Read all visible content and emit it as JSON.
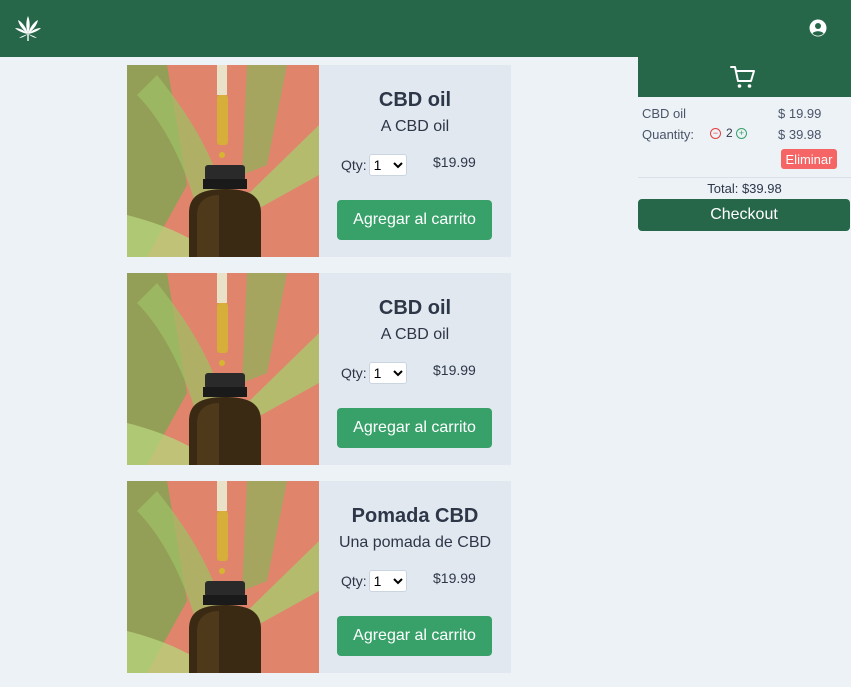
{
  "header": {
    "logo_icon": "cannabis-leaf-icon",
    "user_icon": "user-circle-icon",
    "bg_color": "#276749"
  },
  "products": [
    {
      "title": "CBD oil",
      "description": "A CBD oil",
      "qty_label": "Qty:",
      "qty_value": "1",
      "price": "$19.99",
      "add_label": "Agregar al carrito"
    },
    {
      "title": "CBD oil",
      "description": "A CBD oil",
      "qty_label": "Qty:",
      "qty_value": "1",
      "price": "$19.99",
      "add_label": "Agregar al carrito"
    },
    {
      "title": "Pomada CBD",
      "description": "Una pomada de CBD",
      "qty_label": "Qty:",
      "qty_value": "1",
      "price": "$19.99",
      "add_label": "Agregar al carrito"
    }
  ],
  "cart": {
    "icon": "shopping-cart-icon",
    "items": [
      {
        "name": "CBD oil",
        "unit_price": "$ 19.99",
        "quantity_label": "Quantity:",
        "quantity": "2",
        "line_total": "$ 39.98",
        "remove_label": "Eliminar"
      }
    ],
    "total": "Total: $39.98",
    "checkout_label": "Checkout"
  },
  "colors": {
    "accent": "#38a169",
    "danger": "#f56565",
    "dark_green": "#276749"
  }
}
